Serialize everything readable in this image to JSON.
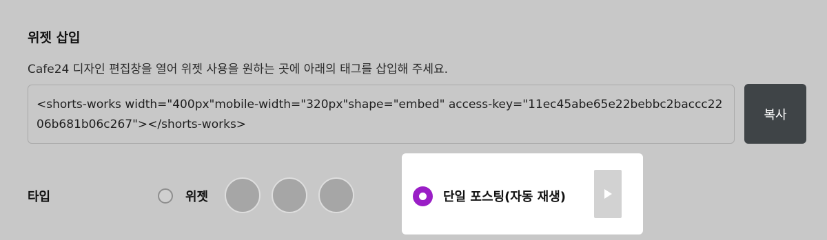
{
  "widget_insert": {
    "title": "위젯 삽입",
    "description": "Cafe24 디자인 편집창을 열어 위젯 사용을 원하는 곳에 아래의 태그를 삽입해 주세요.",
    "code": "<shorts-works width=\"400px\"mobile-width=\"320px\"shape=\"embed\" access-key=\"11ec45abe65e22bebbc2baccc2206b681b06c267\"></shorts-works>",
    "copy_label": "복사"
  },
  "type_selector": {
    "label": "타입",
    "options": [
      {
        "label": "위젯",
        "selected": false
      },
      {
        "label": "단일 포스팅(자동 재생)",
        "selected": true
      }
    ],
    "thumbnail_count": 3
  },
  "colors": {
    "background": "#c8c8c8",
    "copy_button": "#3f4447",
    "selected_radio": "#9a1ec6",
    "card": "#ffffff"
  },
  "icons": {
    "play": "play-icon",
    "radio_selected": "radio-selected-icon",
    "radio_unselected": "radio-unselected-icon"
  }
}
